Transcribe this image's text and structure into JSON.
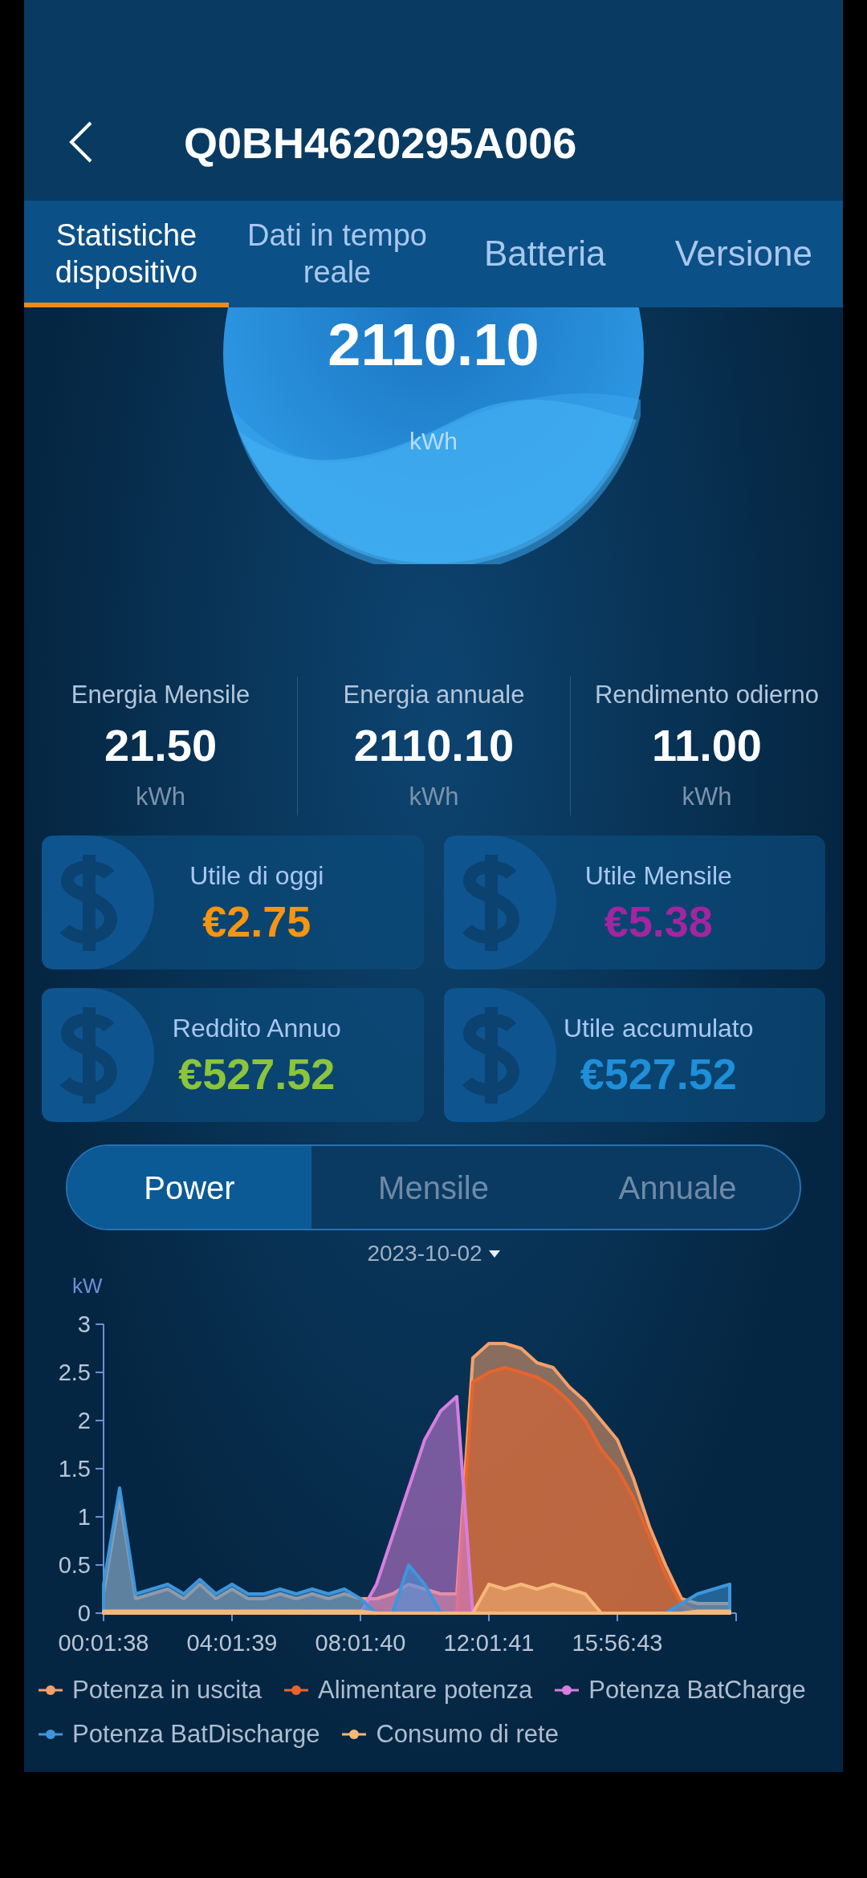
{
  "header": {
    "title": "Q0BH4620295A006"
  },
  "tabs": [
    {
      "label": "Statistiche dispositivo",
      "selected": true
    },
    {
      "label": "Dati in tempo reale",
      "selected": false
    },
    {
      "label": "Batteria",
      "selected": false
    },
    {
      "label": "Versione",
      "selected": false
    }
  ],
  "total": {
    "value": "2110.10",
    "unit": "kWh"
  },
  "stats": [
    {
      "label": "Energia Mensile",
      "value": "21.50",
      "unit": "kWh"
    },
    {
      "label": "Energia annuale",
      "value": "2110.10",
      "unit": "kWh"
    },
    {
      "label": "Rendimento odierno",
      "value": "11.00",
      "unit": "kWh"
    }
  ],
  "profit_cards": [
    {
      "label": "Utile di oggi",
      "value": "€2.75",
      "color": "#f59512"
    },
    {
      "label": "Utile Mensile",
      "value": "€5.38",
      "color": "#a3259f"
    },
    {
      "label": "Reddito Annuo",
      "value": "€527.52",
      "color": "#8cc43c"
    },
    {
      "label": "Utile accumulato",
      "value": "€527.52",
      "color": "#1e8fd8"
    }
  ],
  "period_tabs": [
    {
      "label": "Power",
      "selected": true
    },
    {
      "label": "Mensile",
      "selected": false
    },
    {
      "label": "Annuale",
      "selected": false
    }
  ],
  "date": "2023-10-02",
  "chart_data": {
    "type": "area",
    "ylabel": "kW",
    "categories": [
      "00:01:38",
      null,
      null,
      null,
      null,
      null,
      null,
      null,
      "04:01:39",
      null,
      null,
      null,
      null,
      null,
      null,
      null,
      "08:01:40",
      null,
      null,
      null,
      null,
      null,
      null,
      null,
      "12:01:41",
      null,
      null,
      null,
      null,
      null,
      null,
      null,
      "15:56:43",
      null,
      null,
      null,
      null,
      null,
      null,
      null
    ],
    "ylim": [
      0,
      3
    ],
    "yticks": [
      0,
      0.5,
      1,
      1.5,
      2,
      2.5,
      3
    ],
    "series": [
      {
        "name": "Potenza in uscita",
        "color": "#f4a06a",
        "values": [
          0.2,
          1.2,
          0.15,
          0.2,
          0.25,
          0.15,
          0.3,
          0.15,
          0.25,
          0.15,
          0.15,
          0.2,
          0.15,
          0.2,
          0.15,
          0.2,
          0.15,
          0.15,
          0.2,
          0.3,
          0.25,
          0.2,
          0.2,
          2.65,
          2.8,
          2.8,
          2.75,
          2.6,
          2.55,
          2.35,
          2.2,
          2.0,
          1.8,
          1.4,
          0.9,
          0.5,
          0.15,
          0.1,
          0.1,
          0.1
        ]
      },
      {
        "name": "Alimentare potenza",
        "color": "#e8642c",
        "values": [
          0,
          0,
          0,
          0,
          0,
          0,
          0,
          0,
          0,
          0,
          0,
          0,
          0,
          0,
          0,
          0,
          0,
          0,
          0,
          0,
          0,
          0,
          0,
          2.4,
          2.5,
          2.55,
          2.5,
          2.45,
          2.35,
          2.2,
          2.0,
          1.7,
          1.5,
          1.2,
          0.8,
          0.4,
          0.1,
          0,
          0,
          0
        ]
      },
      {
        "name": "Potenza BatCharge",
        "color": "#d67fe0",
        "values": [
          0,
          0,
          0,
          0,
          0,
          0,
          0,
          0,
          0,
          0,
          0,
          0,
          0,
          0,
          0,
          0,
          0,
          0.3,
          0.8,
          1.3,
          1.8,
          2.1,
          2.25,
          0,
          0,
          0,
          0,
          0,
          0,
          0,
          0,
          0,
          0,
          0,
          0,
          0,
          0,
          0,
          0,
          0
        ]
      },
      {
        "name": "Potenza BatDischarge",
        "color": "#3d96dc",
        "values": [
          0.3,
          1.3,
          0.2,
          0.25,
          0.3,
          0.2,
          0.35,
          0.2,
          0.3,
          0.2,
          0.2,
          0.25,
          0.2,
          0.25,
          0.2,
          0.25,
          0.15,
          0,
          0,
          0.5,
          0.3,
          0,
          0,
          0,
          0,
          0,
          0,
          0,
          0,
          0,
          0,
          0,
          0,
          0,
          0,
          0,
          0.1,
          0.2,
          0.25,
          0.3
        ]
      },
      {
        "name": "Consumo di rete",
        "color": "#f6b87a",
        "values": [
          0.02,
          0.02,
          0.02,
          0.02,
          0.02,
          0.02,
          0.02,
          0.02,
          0.02,
          0.02,
          0.02,
          0.02,
          0.02,
          0.02,
          0.02,
          0.02,
          0.02,
          0,
          0,
          0,
          0,
          0,
          0,
          0,
          0.3,
          0.25,
          0.3,
          0.25,
          0.3,
          0.25,
          0.2,
          0,
          0,
          0,
          0,
          0,
          0,
          0.02,
          0.02,
          0.02
        ]
      }
    ]
  }
}
